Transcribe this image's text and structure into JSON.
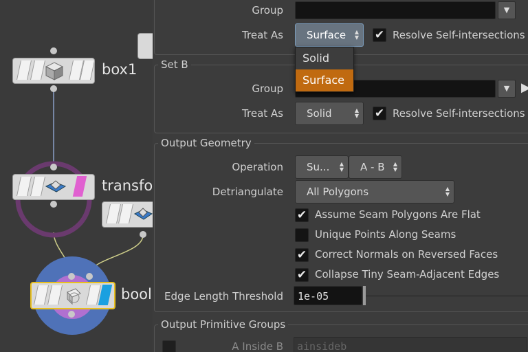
{
  "network": {
    "nodes": [
      {
        "name": "box1"
      },
      {
        "name": "transfo"
      },
      {
        "name": "bool"
      }
    ]
  },
  "setA": {
    "group_label": "Group",
    "group_value": "",
    "treat_as_label": "Treat As",
    "treat_as_value": "Surface",
    "resolve_label": "Resolve Self-intersections",
    "resolve_checked": true,
    "dropdown_options": [
      "Solid",
      "Surface"
    ],
    "dropdown_selected": "Surface"
  },
  "setB": {
    "title": "Set B",
    "group_label": "Group",
    "group_value": "",
    "treat_as_label": "Treat As",
    "treat_as_value": "Solid",
    "resolve_label": "Resolve Self-intersections",
    "resolve_checked": true
  },
  "output_geometry": {
    "title": "Output Geometry",
    "operation_label": "Operation",
    "operation_value": "Su...",
    "operation_sub_value": "A - B",
    "detriangulate_label": "Detriangulate",
    "detriangulate_value": "All Polygons",
    "checkboxes": [
      {
        "label": "Assume Seam Polygons Are Flat",
        "checked": true
      },
      {
        "label": "Unique Points Along Seams",
        "checked": false
      },
      {
        "label": "Correct Normals on Reversed Faces",
        "checked": true
      },
      {
        "label": "Collapse Tiny Seam-Adjacent Edges",
        "checked": true
      }
    ],
    "edge_threshold_label": "Edge Length Threshold",
    "edge_threshold_value": "1e-05"
  },
  "output_primitive_groups": {
    "title": "Output Primitive Groups",
    "a_inside_b_label": "A Inside B",
    "a_inside_b_value": "ainsideb"
  },
  "colors": {
    "selected_menu": "#c06a10",
    "node_pink": "#e060d0",
    "node_blue": "#1aa0e0",
    "ring_purple": "#6a3a6e",
    "circle_blue": "#4f72b8",
    "circle_purple": "#b070d0"
  }
}
